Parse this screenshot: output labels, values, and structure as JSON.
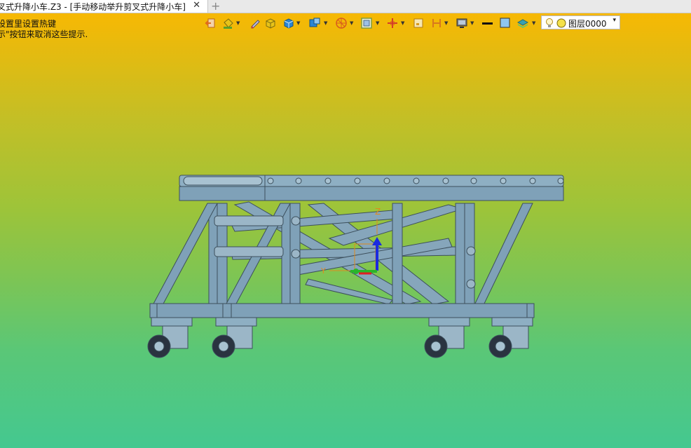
{
  "window": {
    "tab_title": "叉式升降小车.Z3 - [手动移动举升剪叉式升降小车]",
    "close_glyph": "✕",
    "add_tab_glyph": "+"
  },
  "hints": [
    "设置里设置热键",
    "示\"按钮来取消这些提示."
  ],
  "toolbar": {
    "buttons": [
      {
        "name": "exit-icon",
        "color": "#e06c1a"
      },
      {
        "name": "paint-bucket-icon",
        "color": "#5aa02c"
      },
      {
        "name": "pen-icon",
        "color": "#6a6a9a"
      },
      {
        "name": "cube-yellow-icon",
        "color": "#e7c319"
      },
      {
        "name": "cube-blue-icon",
        "color": "#2a86d4"
      },
      {
        "name": "view-cube-icon",
        "color": "#2a86d4"
      },
      {
        "name": "compass-icon",
        "color": "#d85a1e"
      },
      {
        "name": "frame-icon",
        "color": "#7f9a3e"
      },
      {
        "name": "axis-icon",
        "color": "#d43a2a"
      },
      {
        "name": "note-icon",
        "color": "#d89a1e"
      },
      {
        "name": "bracket-icon",
        "color": "#d8781e"
      },
      {
        "name": "monitor-icon",
        "color": "#555555"
      },
      {
        "name": "line-icon",
        "color": "#111111"
      },
      {
        "name": "rect-icon",
        "color": "#4a9ad8"
      },
      {
        "name": "layers-icon",
        "color": "#3aa0b0"
      }
    ],
    "caret": "▼"
  },
  "layer": {
    "label": "图层0000",
    "arrow": "▾"
  },
  "axes": {
    "z": "Z",
    "y": "Y"
  },
  "colors": {
    "frame": "#7fa1b8",
    "frame_dark": "#3c4f5c",
    "axis_z": "#1b2ae0",
    "axis_x": "#e02020",
    "axis_y": "#2ab52a",
    "axis_label": "#e08a1e"
  }
}
